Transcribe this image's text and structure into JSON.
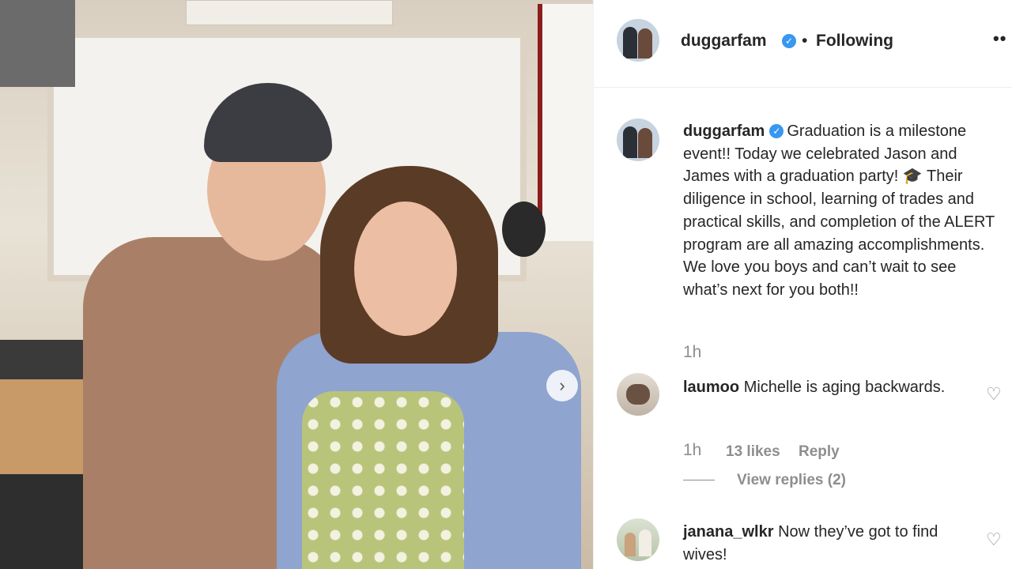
{
  "post": {
    "username": "duggarfam",
    "follow_status": "Following",
    "more_label": "••",
    "next_arrow": "›",
    "caption_text": "Graduation is a milestone event!! Today we celebrated Jason and James with a graduation party! 🎓 Their diligence in school, learning of trades and practical skills, and completion of the ALERT program are all amazing accomplishments. We love you boys and can’t wait to see what’s next for you both!!",
    "caption_time": "1h"
  },
  "comments": [
    {
      "username": "laumoo",
      "text": "Michelle is aging backwards.",
      "time": "1h",
      "likes": "13 likes",
      "reply_label": "Reply",
      "view_replies": "View replies (2)"
    },
    {
      "username": "janana_wlkr",
      "text": "Now they’ve got to find wives!"
    }
  ],
  "colors": {
    "verified": "#3897f0",
    "text": "#262626",
    "muted": "#8e8e8e"
  },
  "icons": {
    "verified": "verified-badge-icon",
    "heart": "heart-icon",
    "more": "more-options-icon",
    "next": "chevron-right-icon"
  }
}
